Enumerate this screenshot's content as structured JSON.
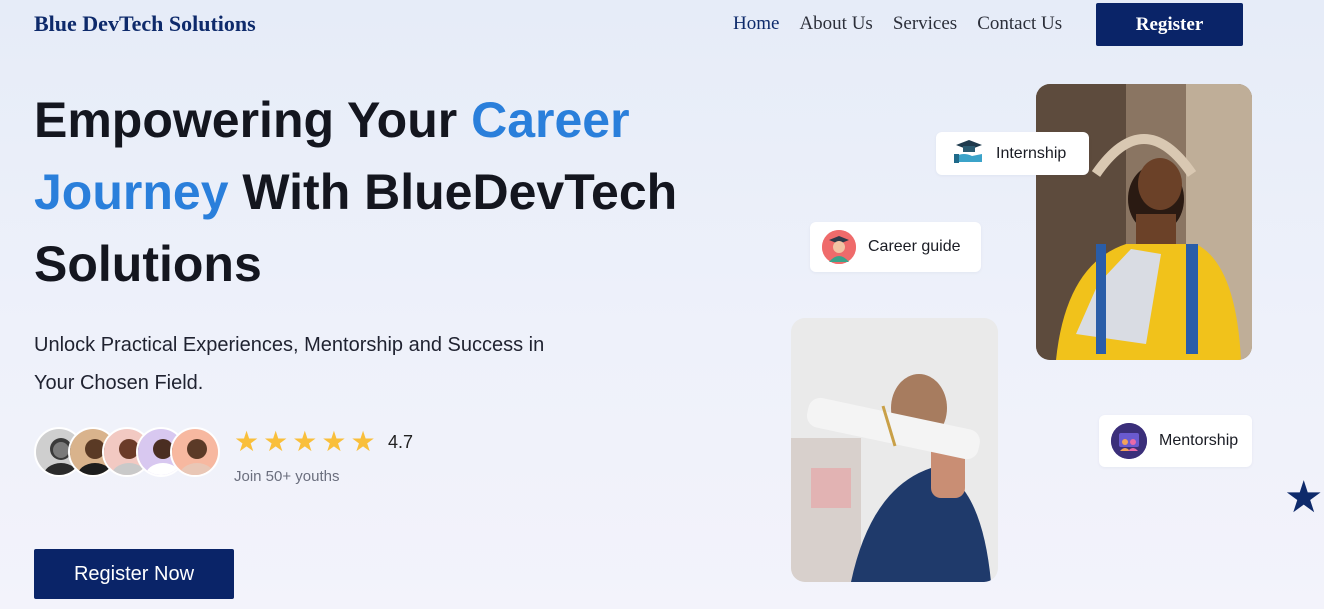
{
  "brand": "Blue DevTech Solutions",
  "nav": {
    "items": [
      "Home",
      "About Us",
      "Services",
      "Contact Us"
    ],
    "register_label": "Register"
  },
  "hero": {
    "headline_part1": "Empowering Your ",
    "headline_accent1": "Career",
    "headline_accent2": "Journey",
    "headline_part2": " With BlueDevTech Solutions",
    "subtext": "Unlock Practical Experiences, Mentorship and Success in Your Chosen Field.",
    "rating": "4.7",
    "star_count": 5,
    "join_text": "Join 50+ youths",
    "cta_label": "Register Now"
  },
  "chips": {
    "internship": "Internship",
    "career_guide": "Career guide",
    "mentorship": "Mentorship"
  },
  "colors": {
    "primary": "#0a2468",
    "accent": "#2a7fdb",
    "star": "#f9bf3b"
  },
  "icons": [
    "graduation-hand-icon",
    "career-guide-icon",
    "mentorship-icon",
    "star-icon"
  ]
}
